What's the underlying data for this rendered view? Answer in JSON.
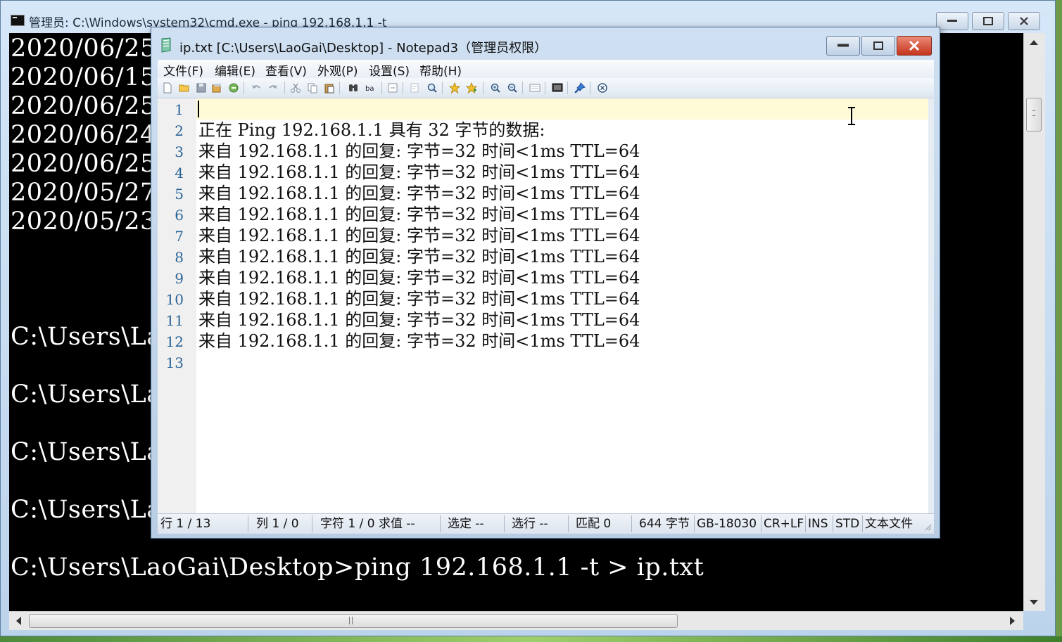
{
  "cmd": {
    "title": "管理员: C:\\Windows\\system32\\cmd.exe - ping  192.168.1.1 -t",
    "visible_lines": [
      "2020/06/25",
      "2020/06/15",
      "2020/06/25",
      "2020/06/24",
      "2020/06/25",
      "2020/05/27",
      "2020/05/23"
    ],
    "prompts": [
      "C:\\Users\\La",
      "C:\\Users\\La",
      "C:\\Users\\La",
      "C:\\Users\\La"
    ],
    "command_line": "C:\\Users\\LaoGai\\Desktop>ping 192.168.1.1 -t > ip.txt"
  },
  "notepad": {
    "title": "ip.txt [C:\\Users\\LaoGai\\Desktop] - Notepad3（管理员权限）",
    "menu": [
      "文件(F)",
      "编辑(E)",
      "查看(V)",
      "外观(P)",
      "设置(S)",
      "帮助(H)"
    ],
    "line_numbers": [
      "1",
      "2",
      "3",
      "4",
      "5",
      "6",
      "7",
      "8",
      "9",
      "10",
      "11",
      "12",
      "13"
    ],
    "lines": [
      "",
      "正在 Ping 192.168.1.1 具有 32 字节的数据:",
      "来自 192.168.1.1 的回复: 字节=32 时间<1ms TTL=64",
      "来自 192.168.1.1 的回复: 字节=32 时间<1ms TTL=64",
      "来自 192.168.1.1 的回复: 字节=32 时间<1ms TTL=64",
      "来自 192.168.1.1 的回复: 字节=32 时间<1ms TTL=64",
      "来自 192.168.1.1 的回复: 字节=32 时间<1ms TTL=64",
      "来自 192.168.1.1 的回复: 字节=32 时间<1ms TTL=64",
      "来自 192.168.1.1 的回复: 字节=32 时间<1ms TTL=64",
      "来自 192.168.1.1 的回复: 字节=32 时间<1ms TTL=64",
      "来自 192.168.1.1 的回复: 字节=32 时间<1ms TTL=64",
      "来自 192.168.1.1 的回复: 字节=32 时间<1ms TTL=64",
      ""
    ],
    "status": {
      "line": "行 1 / 13",
      "col": "列 1 / 0",
      "char": "字符 1 / 0 求值 --",
      "selection": "选定 --",
      "sel_lines": "选行 --",
      "matches": "匹配 0",
      "size": "644 字节",
      "encoding": "GB-18030",
      "eol": "CR+LF",
      "ins": "INS",
      "std": "STD",
      "filetype": "文本文件"
    },
    "toolbar_icons": [
      "new-icon",
      "open-icon",
      "save-icon",
      "save-as-icon",
      "revert-icon",
      "undo-icon",
      "redo-icon",
      "cut-icon",
      "copy-icon",
      "paste-icon",
      "find-icon",
      "replace-icon",
      "goto-icon",
      "wordwrap-icon",
      "zoom-icon",
      "favorite-icon",
      "add-favorite-icon",
      "zoom-in-icon",
      "zoom-out-icon",
      "view-icon",
      "scheme-icon",
      "pin-icon",
      "close-file-icon"
    ]
  }
}
